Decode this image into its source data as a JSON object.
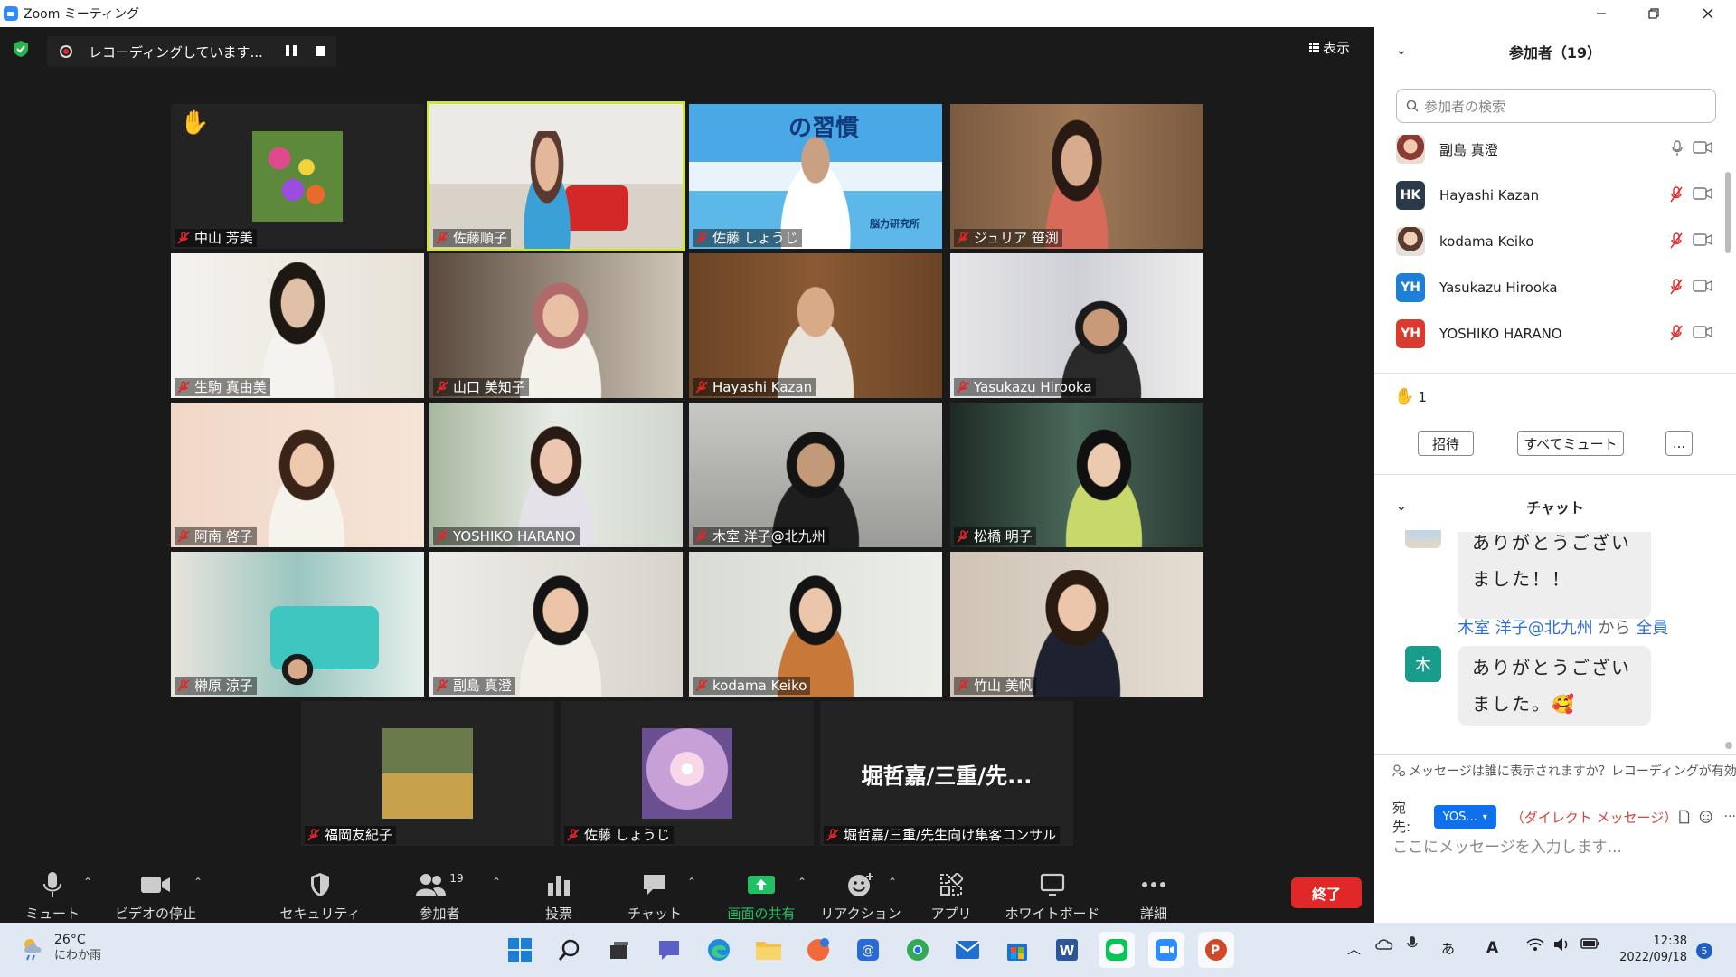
{
  "window": {
    "title": "Zoom ミーティング"
  },
  "recording": {
    "text": "レコーディングしています..."
  },
  "view_label": "表示",
  "tiles": [
    {
      "name": "中山 芳美",
      "hand": "✋"
    },
    {
      "name": "佐藤順子"
    },
    {
      "name": "佐藤 しょうじ",
      "overlay": "の習慣",
      "brand": "脳力研究所"
    },
    {
      "name": "ジュリア 笹渕"
    },
    {
      "name": "生駒 真由美"
    },
    {
      "name": "山口 美知子"
    },
    {
      "name": "Hayashi Kazan"
    },
    {
      "name": "Yasukazu Hirooka"
    },
    {
      "name": "阿南 啓子"
    },
    {
      "name": "YOSHIKO HARANO"
    },
    {
      "name": "木室 洋子@北九州"
    },
    {
      "name": "松橋 明子"
    },
    {
      "name": "榊原 涼子"
    },
    {
      "name": "副島 真澄"
    },
    {
      "name": "kodama Keiko"
    },
    {
      "name": "竹山 美帆"
    },
    {
      "name": "福岡友紀子"
    },
    {
      "name": "佐藤 しょうじ"
    },
    {
      "name": "堀哲嘉/三重/先生向け集客コンサル",
      "display": "堀哲嘉/三重/先..."
    }
  ],
  "toolbar": {
    "mute": "ミュート",
    "video": "ビデオの停止",
    "security": "セキュリティ",
    "participants": "参加者",
    "participants_count": "19",
    "polls": "投票",
    "chat": "チャット",
    "share": "画面の共有",
    "reactions": "リアクション",
    "apps": "アプリ",
    "whiteboard": "ホワイトボード",
    "more": "詳細",
    "end": "終了"
  },
  "panel": {
    "participants_title": "参加者（19）",
    "search_placeholder": "参加者の検索",
    "participants": [
      {
        "name": "副島 真澄",
        "initials": "",
        "color": "#c98a7a"
      },
      {
        "name": "Hayashi Kazan",
        "initials": "HK",
        "color": "#2b3a4a"
      },
      {
        "name": "kodama Keiko",
        "initials": "",
        "color": "#b9a48c"
      },
      {
        "name": "Yasukazu Hirooka",
        "initials": "YH",
        "color": "#1f7fd6"
      },
      {
        "name": "YOSHIKO HARANO",
        "initials": "YH",
        "color": "#d93b30"
      }
    ],
    "raised_hands": "1",
    "invite": "招待",
    "mute_all": "すべてミュート",
    "more": "...",
    "chat_title": "チャット",
    "chat_messages": [
      {
        "text_lines": [
          "ありがとうござい",
          "ました！！"
        ]
      },
      {
        "sender": "木室 洋子@北九州",
        "from_word": "から",
        "to": "全員",
        "avatar": "木",
        "text_lines": [
          "ありがとうござい",
          "ました。"
        ],
        "emoji": "🥰"
      }
    ],
    "visibility_note": "メッセージは誰に表示されますか？レコーディングが有効",
    "to_label": "宛先:",
    "to_value": "YOS...",
    "direct": "（ダイレクト メッセージ）",
    "input_placeholder": "ここにメッセージを入力します..."
  },
  "taskbar": {
    "temp": "26°C",
    "weather": "にわか雨",
    "time": "12:38",
    "date": "2022/09/18",
    "notifications": "5",
    "ime": "あ",
    "ime2": "A"
  },
  "colors": {
    "accent": "#2d8cff",
    "active_speaker": "#cfe43a",
    "end": "#e02828",
    "share": "#21c064"
  }
}
